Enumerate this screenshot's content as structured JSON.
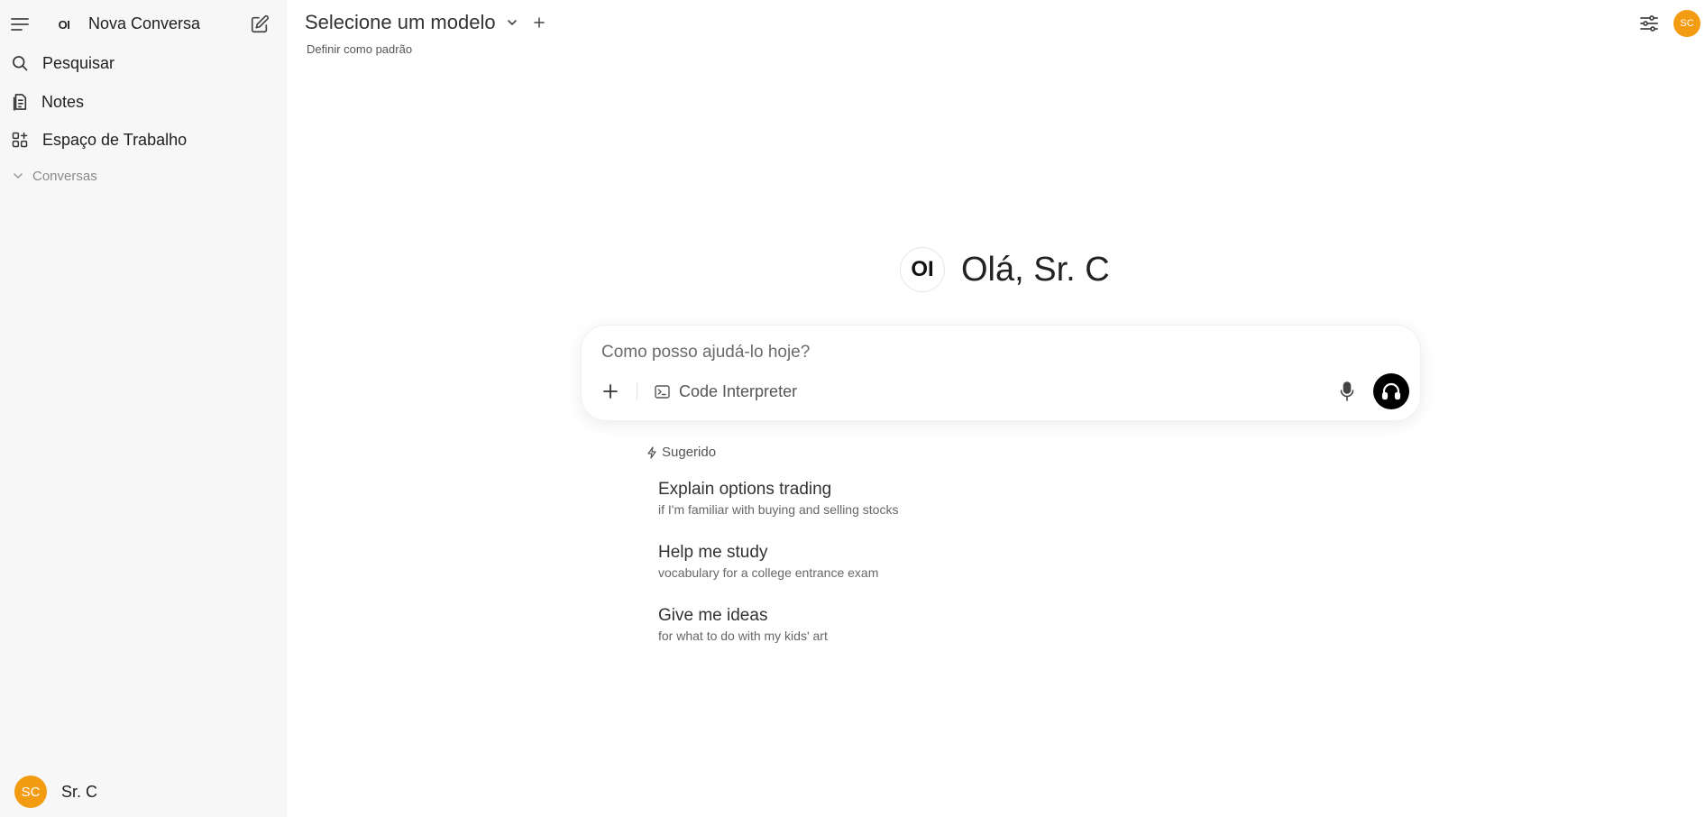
{
  "sidebar": {
    "title": "Nova Conversa",
    "logo_text": "OI",
    "items": [
      {
        "label": "Pesquisar",
        "icon": "search-icon"
      },
      {
        "label": "Notes",
        "icon": "notes-icon"
      },
      {
        "label": "Espaço de Trabalho",
        "icon": "workspace-icon"
      }
    ],
    "section_label": "Conversas",
    "user": {
      "initials": "SC",
      "name": "Sr. C"
    }
  },
  "header": {
    "model_title": "Selecione um modelo",
    "set_default": "Definir como padrão",
    "avatar_initials": "SC"
  },
  "main": {
    "logo_text": "OI",
    "greeting": "Olá, Sr. C",
    "composer": {
      "placeholder": "Como posso ajudá-lo hoje?",
      "tool_label": "Code Interpreter"
    },
    "suggested_label": "Sugerido",
    "suggestions": [
      {
        "title": "Explain options trading",
        "subtitle": "if I'm familiar with buying and selling stocks"
      },
      {
        "title": "Help me study",
        "subtitle": "vocabulary for a college entrance exam"
      },
      {
        "title": "Give me ideas",
        "subtitle": "for what to do with my kids' art"
      }
    ]
  },
  "colors": {
    "avatar": "#f39c12",
    "sidebar_bg": "#f7f7f7",
    "voice_button": "#000000"
  }
}
